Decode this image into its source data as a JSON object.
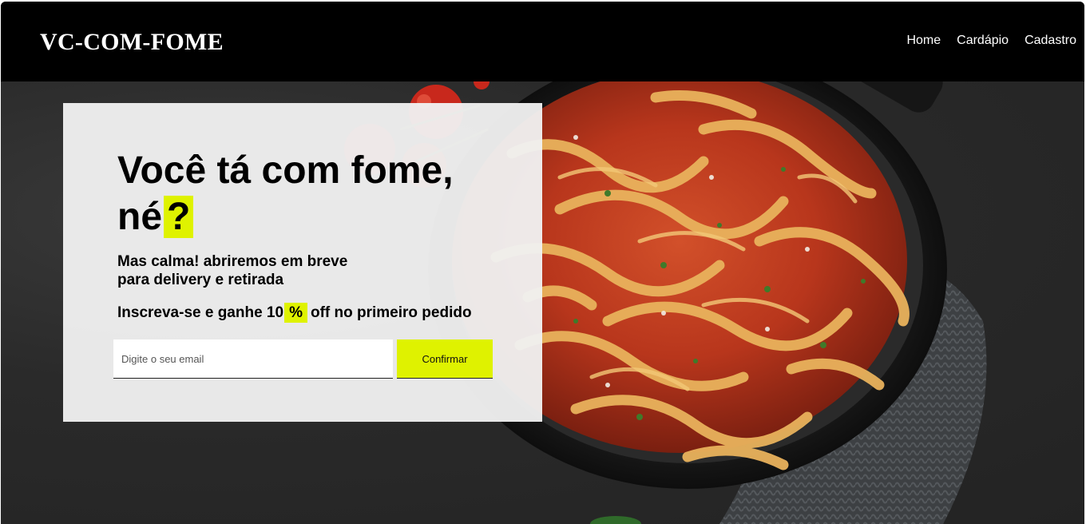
{
  "header": {
    "logo": "VC-COM-FOME",
    "nav": [
      "Home",
      "Cardápio",
      "Cadastro"
    ]
  },
  "hero": {
    "headline_line1": "Você tá com fome,",
    "headline_word": "né",
    "headline_mark": "?",
    "subtext_line1": "Mas calma! abriremos em breve",
    "subtext_line2": "para delivery e retirada",
    "offer_prefix": "Inscreva-se e ganhe 10",
    "offer_mark": "%",
    "offer_suffix": "off no primeiro pedido"
  },
  "form": {
    "email_placeholder": "Digite o seu email",
    "email_value": "",
    "confirm_label": "Confirmar"
  },
  "colors": {
    "accent": "#dff200",
    "header_bg": "#000000",
    "card_bg": "#f0f0f0"
  },
  "background_image": "pasta-dish-photo"
}
